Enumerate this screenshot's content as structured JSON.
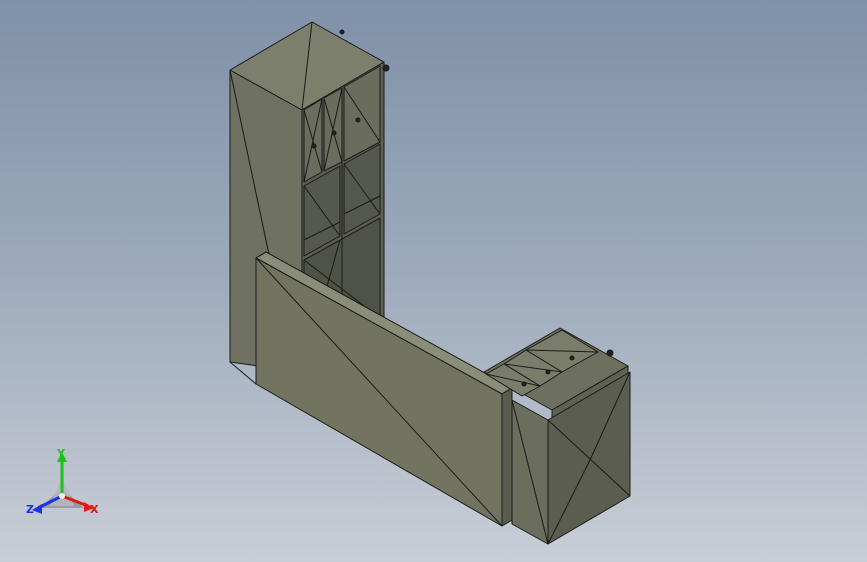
{
  "viewport": {
    "background_top": "#7f91a8",
    "background_bottom": "#c9ced6",
    "model_face_color": "#6f7262",
    "model_edge_color": "#1a1a1a"
  },
  "triad": {
    "x_label": "X",
    "y_label": "Y",
    "z_label": "Z",
    "x_color": "#e01818",
    "y_color": "#1cc21c",
    "z_color": "#1a35e0"
  },
  "model": {
    "parts": [
      "tall-cabinet",
      "drawer-stack",
      "counter-panel",
      "base-cabinet"
    ]
  }
}
